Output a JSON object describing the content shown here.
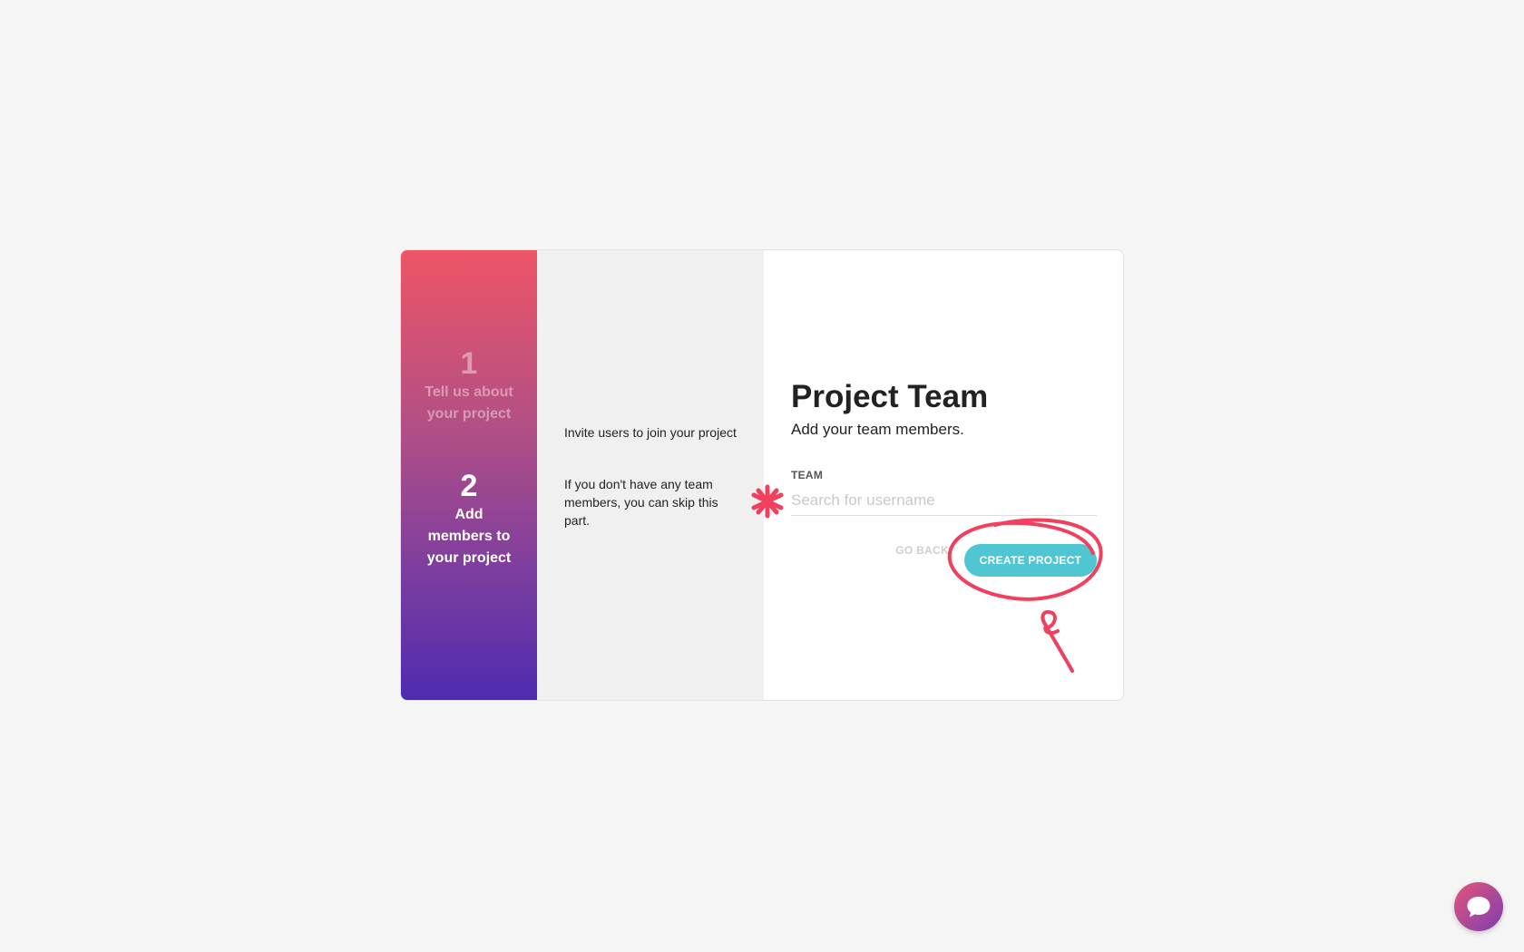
{
  "steps": [
    {
      "number": "1",
      "label": "Tell us about your project"
    },
    {
      "number": "2",
      "label": "Add members to your project"
    }
  ],
  "info": {
    "paragraph1": "Invite users to join your project",
    "paragraph2": "If you don't have any team members, you can skip this part."
  },
  "form": {
    "title": "Project Team",
    "subtitle": "Add your team members.",
    "team_label": "TEAM",
    "team_placeholder": "Search for username",
    "team_value": ""
  },
  "actions": {
    "go_back": "GO BACK",
    "create": "CREATE PROJECT"
  },
  "colors": {
    "accent": "#4fc6d2",
    "annotation": "#f0405e",
    "gradient_top": "#ee5566",
    "gradient_bottom": "#4e2bb0"
  },
  "icons": {
    "chat": "chat-bubble-icon",
    "annotation_marker": "asterisk-icon"
  }
}
